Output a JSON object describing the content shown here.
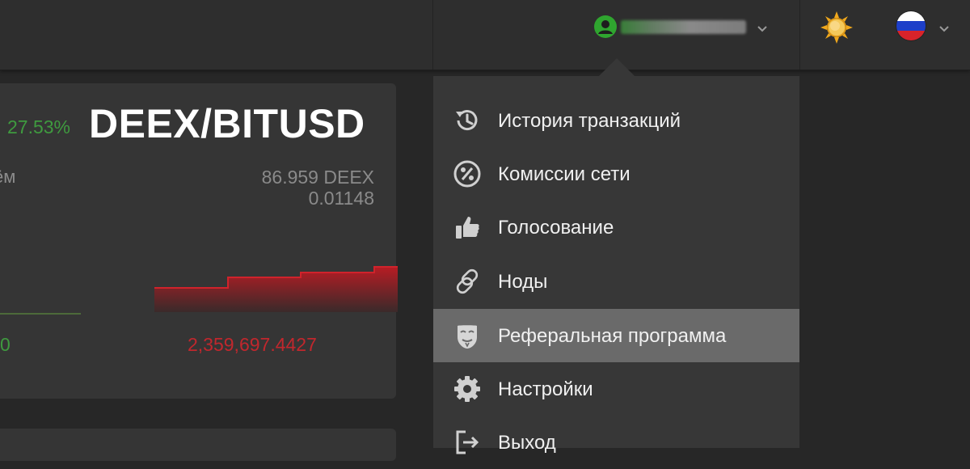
{
  "header": {
    "user_menu": {
      "avatar_icon": "user-icon",
      "chevron_icon": "chevron-down-icon"
    },
    "theme_toggle": {
      "icon": "sun-icon"
    },
    "language": {
      "flag": "russia-flag",
      "chevron_icon": "chevron-down-icon"
    }
  },
  "market": {
    "change_percent": "27.53%",
    "pair": "DEEX/BITUSD",
    "volume_label": "ём",
    "volume_value": "86.959  DEEX",
    "price_value": "0.01148",
    "bid_total": "0",
    "ask_total": "2,359,697.4427"
  },
  "menu": {
    "items": [
      {
        "label": "История транзакций",
        "icon": "history-icon"
      },
      {
        "label": "Комиссии сети",
        "icon": "percent-icon"
      },
      {
        "label": "Голосование",
        "icon": "thumbs-up-icon"
      },
      {
        "label": "Ноды",
        "icon": "link-icon"
      },
      {
        "label": "Реферальная программа",
        "icon": "mask-icon"
      },
      {
        "label": "Настройки",
        "icon": "gear-icon"
      },
      {
        "label": "Выход",
        "icon": "logout-icon"
      }
    ],
    "active_index": 4
  },
  "colors": {
    "accent_green": "#3f9a3f",
    "ask_red": "#c1272d",
    "menu_bg": "#373737",
    "menu_active_bg": "#6a6a6a"
  }
}
